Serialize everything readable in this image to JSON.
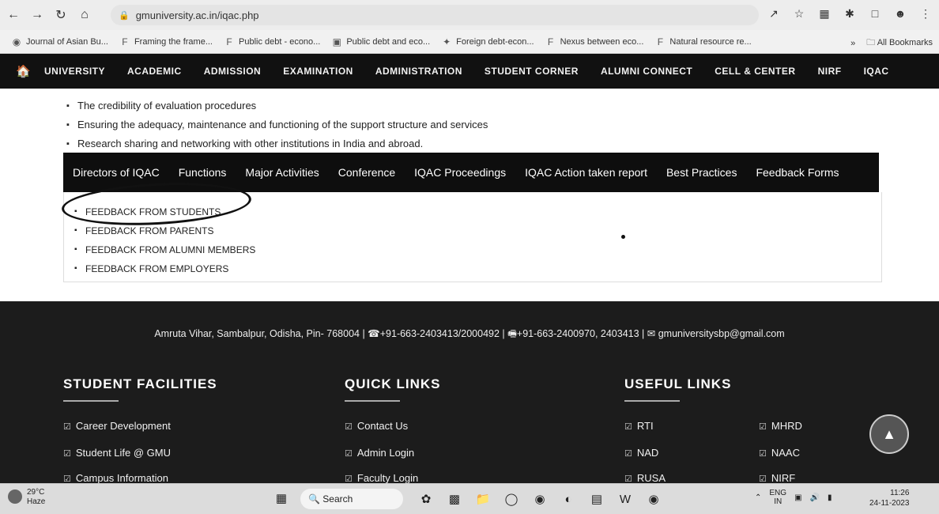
{
  "browser": {
    "url": "gmuniversity.ac.in/iqac.php",
    "bookmarks": [
      "Journal of Asian Bu...",
      "Framing the frame...",
      "Public debt - econo...",
      "Public debt and eco...",
      "Foreign debt-econ...",
      "Nexus between eco...",
      "Natural resource re..."
    ],
    "all_bookmarks": "All Bookmarks",
    "more": "»"
  },
  "site_nav": {
    "items": [
      "UNIVERSITY",
      "ACADEMIC",
      "ADMISSION",
      "EXAMINATION",
      "ADMINISTRATION",
      "STUDENT CORNER",
      "ALUMNI CONNECT",
      "CELL & CENTER",
      "NIRF",
      "IQAC"
    ]
  },
  "content": {
    "bullets": [
      "The credibility of evaluation procedures",
      "Ensuring the adequacy, maintenance and functioning of the support structure and services",
      "Research sharing and networking with other institutions in India and abroad."
    ],
    "tabs": [
      "Directors of IQAC",
      "Functions",
      "Major Activities",
      "Conference",
      "IQAC Proceedings",
      "IQAC Action taken report",
      "Best Practices",
      "Feedback Forms"
    ],
    "feedback": [
      "FEEDBACK FROM STUDENTS",
      "FEEDBACK FROM PARENTS",
      "FEEDBACK FROM ALUMNI MEMBERS",
      "FEEDBACK FROM EMPLOYERS"
    ]
  },
  "footer": {
    "address": "Amruta Vihar, Sambalpur, Odisha, Pin- 768004 | ☎+91-663-2403413/2000492 | 🖷+91-663-2400970, 2403413 | ✉ gmuniversitysbp@gmail.com",
    "student_facilities": {
      "title": "STUDENT FACILITIES",
      "links": [
        "Career Development",
        "Student Life @ GMU",
        "Campus Information"
      ]
    },
    "quick_links": {
      "title": "QUICK LINKS",
      "links": [
        "Contact Us",
        "Admin Login",
        "Faculty Login"
      ]
    },
    "useful_links": {
      "title": "USEFUL LINKS",
      "links_left": [
        "RTI",
        "NAD",
        "RUSA"
      ],
      "links_right": [
        "MHRD",
        "NAAC",
        "NIRF"
      ]
    }
  },
  "taskbar": {
    "temp": "29°C",
    "weather": "Haze",
    "search": "Search",
    "lang1": "ENG",
    "lang2": "IN",
    "time": "11:26",
    "date": "24-11-2023"
  }
}
